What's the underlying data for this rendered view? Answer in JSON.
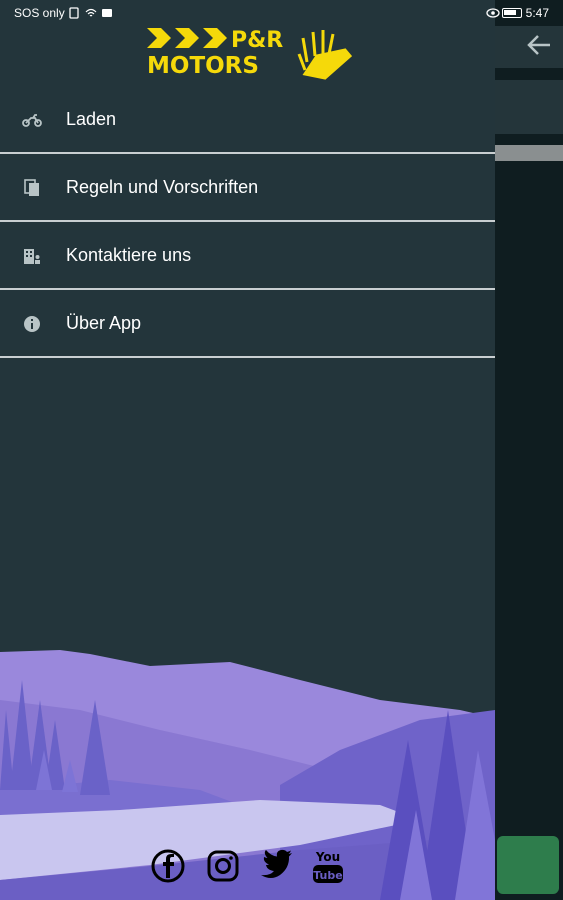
{
  "status_bar": {
    "left_text": "SOS only",
    "time": "5:47"
  },
  "logo": {
    "line1": "P&R",
    "line2": "MOTORS"
  },
  "menu": {
    "items": [
      {
        "label": "Laden",
        "icon": "motorcycle-icon"
      },
      {
        "label": "Regeln und Vorschriften",
        "icon": "documents-icon"
      },
      {
        "label": "Kontaktiere uns",
        "icon": "contact-building-icon"
      },
      {
        "label": "Über App",
        "icon": "info-icon"
      }
    ]
  },
  "socials": [
    "facebook-icon",
    "instagram-icon",
    "twitter-icon",
    "youtube-icon"
  ],
  "youtube_label": {
    "top": "You",
    "bottom": "Tube"
  },
  "colors": {
    "drawer_bg": "#23353b",
    "accent_yellow": "#f5d90a",
    "divider": "#c9cfd1",
    "landscape_purple": "#8f7fd6"
  }
}
